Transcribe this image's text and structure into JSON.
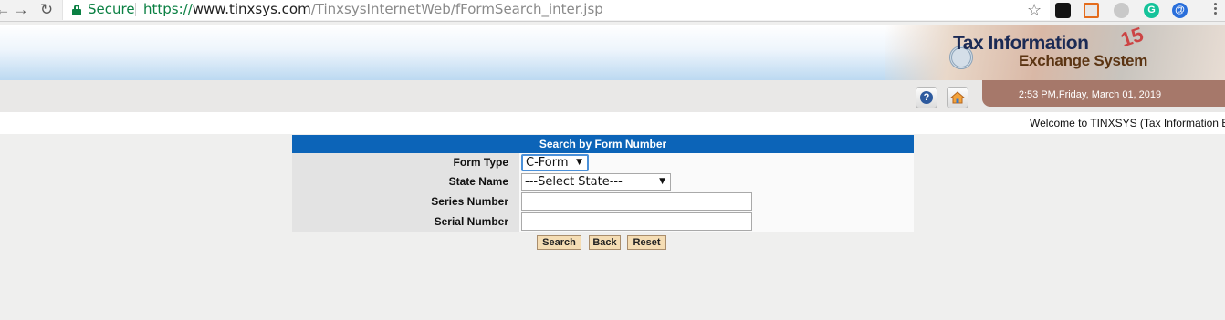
{
  "browser": {
    "secure_label": "Secure",
    "url_scheme": "https://",
    "url_host": "www.tinxsys.com",
    "url_path": "/TinxsysInternetWeb/fFormSearch_inter.jsp",
    "icons": [
      "back-arrow-icon",
      "forward-arrow-icon",
      "reload-icon",
      "lock-icon",
      "bookmark-star-icon",
      "extension-icons",
      "menu-icon"
    ]
  },
  "banner": {
    "title_line1": "Tax Information",
    "title_line2": "Exchange System",
    "stamp_number": "15"
  },
  "infobar": {
    "datetime": "2:53 PM,Friday, March 01, 2019",
    "help_icon": "?"
  },
  "welcome": {
    "text": "Welcome to TINXSYS (Tax Information E"
  },
  "form": {
    "header": "Search by Form Number",
    "fields": {
      "form_type": {
        "label": "Form Type",
        "value": "C-Form"
      },
      "state_name": {
        "label": "State Name",
        "value": "---Select State---"
      },
      "series_number": {
        "label": "Series Number",
        "value": ""
      },
      "serial_number": {
        "label": "Serial Number",
        "value": ""
      }
    },
    "buttons": {
      "search": "Search",
      "back": "Back",
      "reset": "Reset"
    }
  },
  "colors": {
    "form_header_bg": "#0c64b8",
    "button_bg": "#f5ddb4",
    "date_tab_bg": "#a6786a",
    "secure_green": "#0b8043"
  }
}
